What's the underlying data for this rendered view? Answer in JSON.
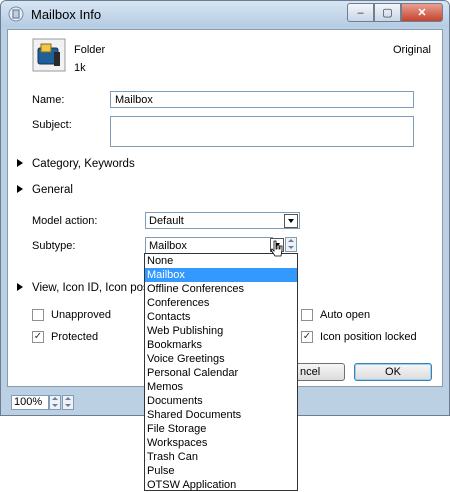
{
  "window": {
    "title": "Mailbox Info",
    "minimize": "‒",
    "maximize": "▢",
    "close": "✕"
  },
  "header": {
    "kind": "Folder",
    "size": "1k",
    "original_label": "Original"
  },
  "form": {
    "name_label": "Name:",
    "name_value": "Mailbox",
    "subject_label": "Subject:",
    "subject_value": "",
    "model_action_label": "Model action:",
    "model_action_value": "Default",
    "subtype_label": "Subtype:",
    "subtype_value": "Mailbox"
  },
  "sections": {
    "category": "Category, Keywords",
    "general": "General",
    "view": "View, Icon ID, Icon posi"
  },
  "checkboxes": {
    "unapproved": {
      "label": "Unapproved",
      "checked": false
    },
    "protected": {
      "label": "Protected",
      "checked": true
    },
    "auto_open": {
      "label": "Auto open",
      "checked": false
    },
    "icon_locked": {
      "label": "Icon position locked",
      "checked": true
    },
    "check_mark": "✓"
  },
  "buttons": {
    "cancel": "ncel",
    "ok": "OK"
  },
  "status": {
    "zoom": "100%"
  },
  "dropdown": {
    "options": [
      "None",
      "Mailbox",
      "Offline Conferences",
      "Conferences",
      "Contacts",
      "Web Publishing",
      "Bookmarks",
      "Voice Greetings",
      "Personal Calendar",
      "Memos",
      "Documents",
      "Shared Documents",
      "File Storage",
      "Workspaces",
      "Trash Can",
      "Pulse",
      "OTSW Application"
    ],
    "selected": "Mailbox"
  },
  "colors": {
    "selection": "#3399ff",
    "frame": "#bcd0e4"
  }
}
